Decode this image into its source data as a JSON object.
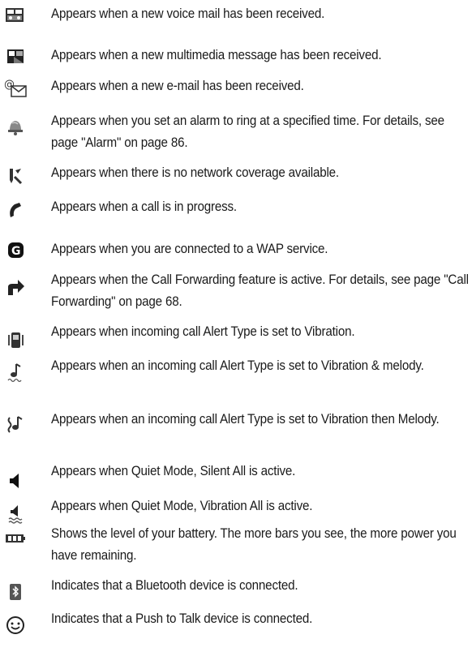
{
  "rows": [
    {
      "icon": "voicemail-icon",
      "text": "Appears when a new voice mail has been received."
    },
    {
      "icon": "multimedia-message-icon",
      "text": "Appears when a new multimedia message has been received."
    },
    {
      "icon": "email-icon",
      "text": "Appears when a new e-mail has been received."
    },
    {
      "icon": "alarm-icon",
      "text": "Appears when you set an alarm to ring at a specified time. For details, see page \"Alarm\" on page 86."
    },
    {
      "icon": "no-network-icon",
      "text": "Appears when there is no network coverage available."
    },
    {
      "icon": "call-in-progress-icon",
      "text": "Appears when a call is in progress."
    },
    {
      "icon": "wap-connected-icon",
      "text": "Appears when you are connected to a WAP service."
    },
    {
      "icon": "call-forwarding-icon",
      "text": "Appears when the Call Forwarding feature is active. For details, see page \"Call Forwarding\" on page 68."
    },
    {
      "icon": "vibration-icon",
      "text": "Appears when incoming call Alert Type is set to Vibration."
    },
    {
      "icon": "vibration-melody-icon",
      "text": "Appears when an incoming call Alert Type is set to Vibration & melody."
    },
    {
      "icon": "vibration-then-melody-icon",
      "text": "Appears when an incoming call Alert Type is set to Vibration then Melody."
    },
    {
      "icon": "silent-all-icon",
      "text": "Appears when Quiet Mode, Silent All is active."
    },
    {
      "icon": "vibration-all-icon",
      "text": "Appears when Quiet Mode, Vibration All is active."
    },
    {
      "icon": "battery-icon",
      "text": "Shows the level of your battery. The more bars you see, the more power you have remaining."
    },
    {
      "icon": "bluetooth-icon",
      "text": "Indicates that a Bluetooth device is connected."
    },
    {
      "icon": "push-to-talk-icon",
      "text": "Indicates that a Push to Talk device is connected."
    }
  ]
}
